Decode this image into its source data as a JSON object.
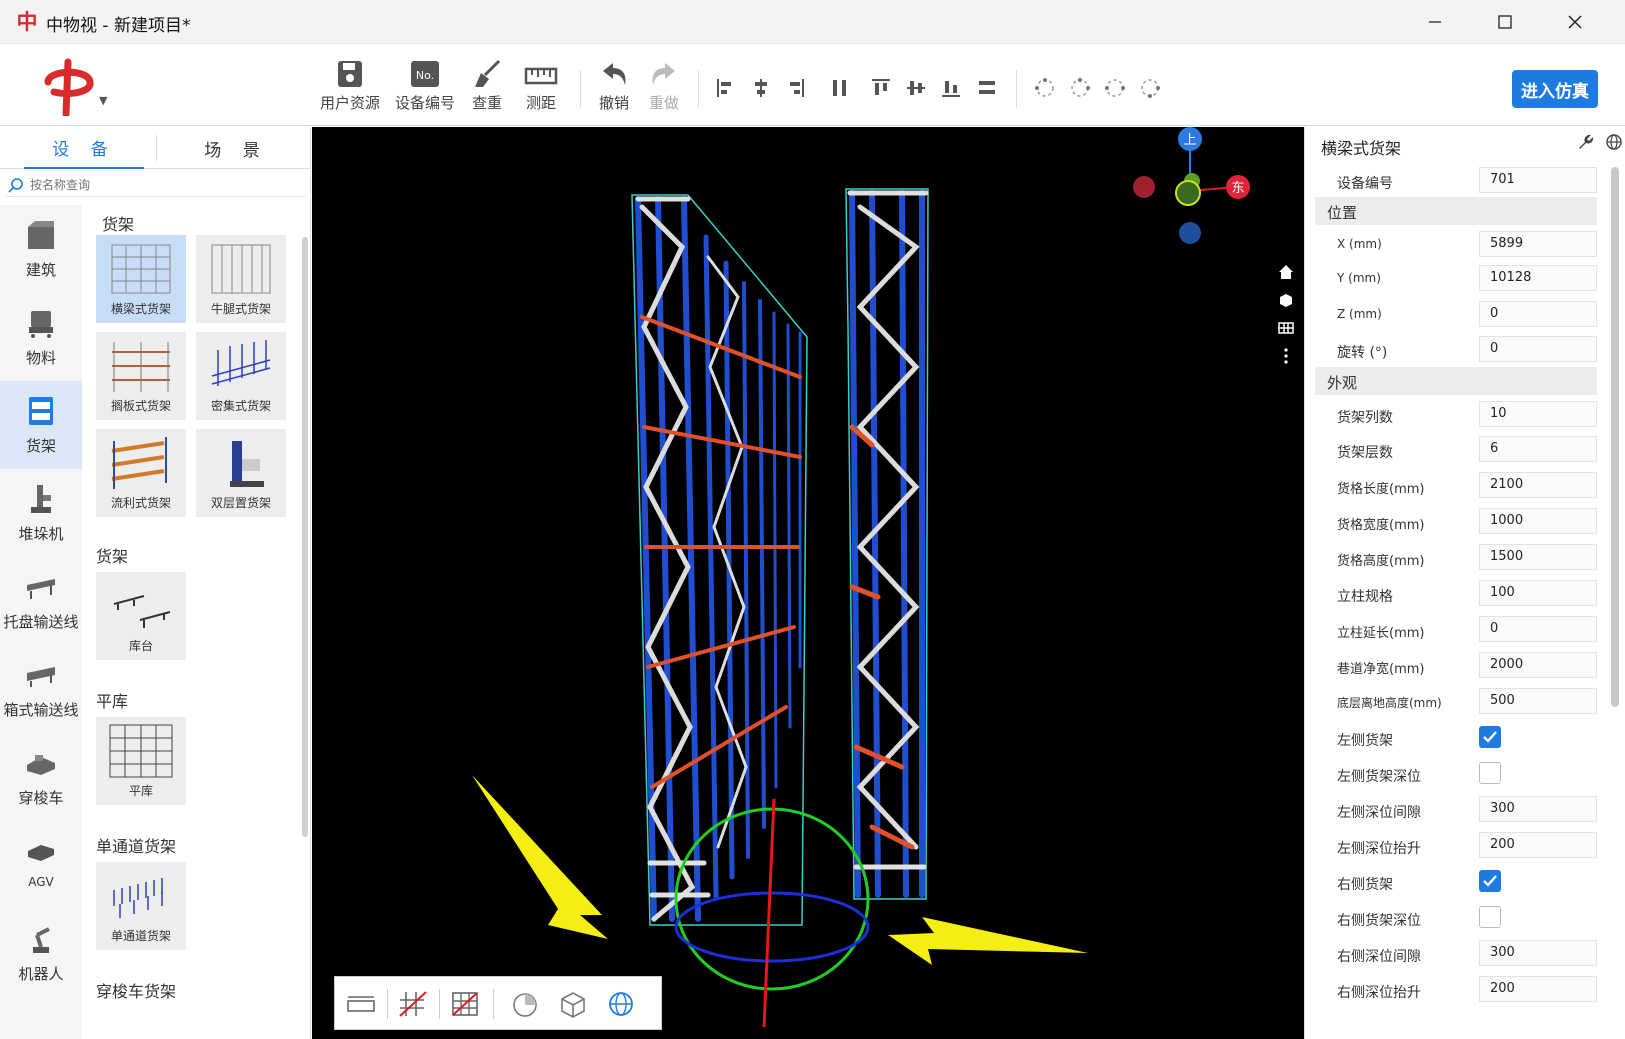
{
  "window": {
    "title": "中物视 - 新建项目*",
    "icon_glyph": "中",
    "controls": [
      "minimize",
      "maximize",
      "close"
    ]
  },
  "toolbar": {
    "tools": [
      {
        "label": "用户资源",
        "icon": "save-user-icon"
      },
      {
        "label": "设备编号",
        "icon": "number-icon"
      },
      {
        "label": "查重",
        "icon": "broom-icon"
      },
      {
        "label": "测距",
        "icon": "ruler-icon"
      },
      {
        "label": "撤销",
        "icon": "undo-icon"
      },
      {
        "label": "重做",
        "icon": "redo-icon",
        "disabled": true
      }
    ],
    "align_icons": [
      "align-left-icon",
      "align-center-h-icon",
      "align-right-icon",
      "distribute-h-icon",
      "align-top-icon",
      "align-center-v-icon",
      "align-bottom-icon",
      "distribute-v-icon"
    ],
    "dot_icons": [
      "ring-icon-1",
      "ring-icon-2",
      "ring-icon-3",
      "ring-icon-4"
    ],
    "enter_sim_label": "进入仿真",
    "no_label": "No."
  },
  "left": {
    "tabs": [
      "设 备",
      "场 景"
    ],
    "search_placeholder": "按名称查询",
    "categories": [
      {
        "label": "建筑",
        "icon": "building-icon"
      },
      {
        "label": "物料",
        "icon": "material-icon"
      },
      {
        "label": "货架",
        "icon": "shelf-icon",
        "active": true
      },
      {
        "label": "堆垛机",
        "icon": "stacker-icon"
      },
      {
        "label": "托盘输送线",
        "icon": "pallet-conveyor-icon"
      },
      {
        "label": "箱式输送线",
        "icon": "box-conveyor-icon"
      },
      {
        "label": "穿梭车",
        "icon": "shuttle-icon"
      },
      {
        "label": "AGV",
        "icon": "agv-icon"
      },
      {
        "label": "机器人",
        "icon": "robot-icon"
      }
    ],
    "sections": [
      {
        "title": "货架",
        "items": [
          "横梁式货架",
          "牛腿式货架",
          "搁板式货架",
          "密集式货架",
          "流利式货架",
          "双层置货架"
        ]
      },
      {
        "title": "货架",
        "items": [
          "库台"
        ]
      },
      {
        "title": "平库",
        "items": [
          "平库"
        ]
      },
      {
        "title": "单通道货架",
        "items": [
          "单通道货架"
        ]
      },
      {
        "title": "穿梭车货架",
        "items": []
      }
    ]
  },
  "viewport": {
    "compass": {
      "up": "上",
      "east": "东"
    },
    "side_icons": [
      "home-icon",
      "cube-icon",
      "grid-icon",
      "more-icon"
    ],
    "bottom_tools": [
      "measure-icon",
      "grid-off-icon",
      "grid-off-2-icon",
      "pie-view-icon",
      "cube-view-icon",
      "globe-view-icon"
    ]
  },
  "props": {
    "title": "横梁式货架",
    "device_no_label": "设备编号",
    "device_no": "701",
    "pos_group": "位置",
    "x_label": "X (mm)",
    "x": "5899",
    "y_label": "Y (mm)",
    "y": "10128",
    "z_label": "Z (mm)",
    "z": "0",
    "rot_label": "旋转 (°)",
    "rot": "0",
    "look_group": "外观",
    "rows": [
      {
        "label": "货架列数",
        "value": "10"
      },
      {
        "label": "货架层数",
        "value": "6"
      },
      {
        "label": "货格长度(mm)",
        "value": "2100"
      },
      {
        "label": "货格宽度(mm)",
        "value": "1000"
      },
      {
        "label": "货格高度(mm)",
        "value": "1500"
      },
      {
        "label": "立柱规格",
        "value": "100"
      },
      {
        "label": "立柱延长(mm)",
        "value": "0"
      },
      {
        "label": "巷道净宽(mm)",
        "value": "2000"
      },
      {
        "label": "底层离地高度(mm)",
        "value": "500"
      }
    ],
    "checks": [
      {
        "label": "左侧货架",
        "checked": true
      },
      {
        "label": "左侧货架深位",
        "checked": false
      }
    ],
    "rows2": [
      {
        "label": "左侧深位间隙",
        "value": "300"
      },
      {
        "label": "左侧深位抬升",
        "value": "200"
      }
    ],
    "checks2": [
      {
        "label": "右侧货架",
        "checked": true
      },
      {
        "label": "右侧货架深位",
        "checked": false
      }
    ],
    "rows3": [
      {
        "label": "右侧深位间隙",
        "value": "300"
      },
      {
        "label": "右侧深位抬升",
        "value": "200"
      }
    ]
  }
}
